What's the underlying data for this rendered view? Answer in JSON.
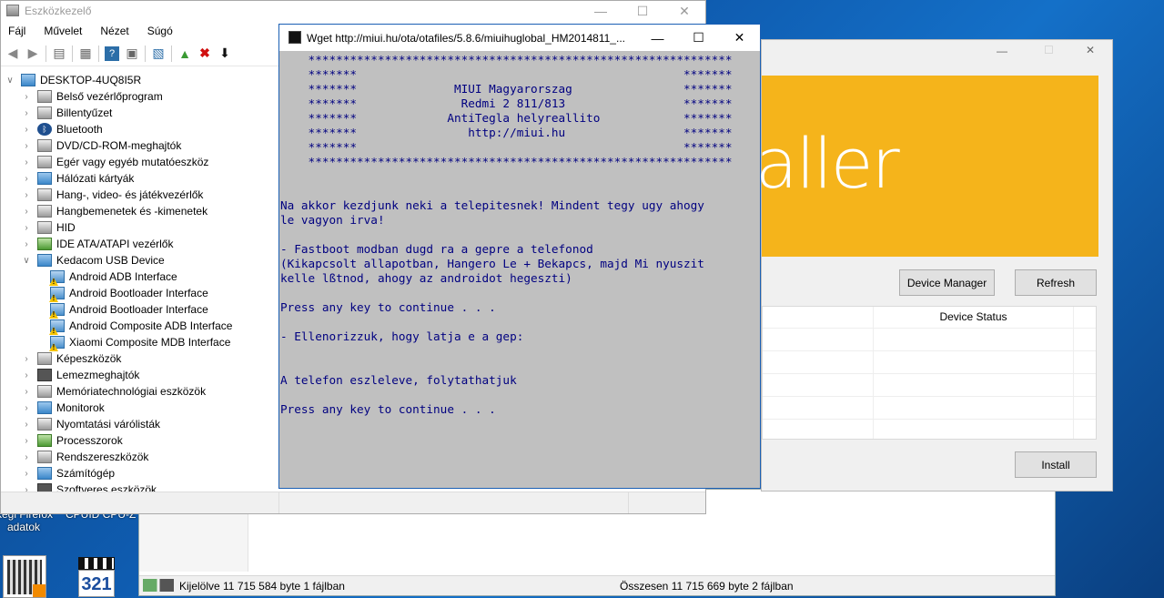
{
  "desktop": {
    "label_left_line1": "kegi Firefox",
    "label_left_line2": "adatok",
    "label_right": "CPUID CPU-Z"
  },
  "explorer": {
    "status_left": "Kijelölve 11 715 584 byte 1 fájlban",
    "status_right": "Összesen 11 715 669 byte 2 fájlban"
  },
  "devmgr": {
    "title": "Eszközkezelő",
    "menu": [
      "Fájl",
      "Művelet",
      "Nézet",
      "Súgó"
    ],
    "root": "DESKTOP-4UQ8I5R",
    "nodes": [
      {
        "label": "Belső vezérlőprogram",
        "icon": "gray"
      },
      {
        "label": "Billentyűzet",
        "icon": "gray"
      },
      {
        "label": "Bluetooth",
        "icon": "bt"
      },
      {
        "label": "DVD/CD-ROM-meghajtók",
        "icon": "gray"
      },
      {
        "label": "Egér vagy egyéb mutatóeszköz",
        "icon": "gray"
      },
      {
        "label": "Hálózati kártyák",
        "icon": "blue"
      },
      {
        "label": "Hang-, video- és játékvezérlők",
        "icon": "gray"
      },
      {
        "label": "Hangbemenetek és -kimenetek",
        "icon": "gray"
      },
      {
        "label": "HID",
        "icon": "gray"
      },
      {
        "label": "IDE ATA/ATAPI vezérlők",
        "icon": "green"
      },
      {
        "label": "Kedacom USB Device",
        "icon": "blue",
        "expanded": true
      },
      {
        "label": "Android ADB Interface",
        "icon": "warn",
        "child": true
      },
      {
        "label": "Android Bootloader Interface",
        "icon": "warn",
        "child": true
      },
      {
        "label": "Android Bootloader Interface",
        "icon": "warn",
        "child": true
      },
      {
        "label": "Android Composite ADB Interface",
        "icon": "warn",
        "child": true
      },
      {
        "label": "Xiaomi Composite MDB Interface",
        "icon": "warn",
        "child": true
      },
      {
        "label": "Képeszközök",
        "icon": "gray"
      },
      {
        "label": "Lemezmeghajtók",
        "icon": "dark"
      },
      {
        "label": "Memóriatechnológiai eszközök",
        "icon": "gray"
      },
      {
        "label": "Monitorok",
        "icon": "blue"
      },
      {
        "label": "Nyomtatási várólisták",
        "icon": "gray"
      },
      {
        "label": "Processzorok",
        "icon": "green"
      },
      {
        "label": "Rendszereszközök",
        "icon": "gray"
      },
      {
        "label": "Számítógép",
        "icon": "blue"
      },
      {
        "label": "Szoftveres eszközök",
        "icon": "dark"
      }
    ]
  },
  "console": {
    "title": "Wget http://miui.hu/ota/otafiles/5.8.6/miuihuglobal_HM2014811_...",
    "text": "    *************************************************************\n    *******                                               *******\n    *******              MIUI Magyarorszag                *******\n    *******               Redmi 2 811/813                 *******\n    *******             AntiTegla helyreallito            *******\n    *******                http://miui.hu                 *******\n    *******                                               *******\n    *************************************************************\n\n\nNa akkor kezdjunk neki a telepitesnek! Mindent tegy ugy ahogy\nle vagyon irva!\n\n- Fastboot modban dugd ra a gepre a telefonod\n(Kikapcsolt allapotban, Hangero Le + Bekapcs, majd Mi nyuszit\nkelle lßtnod, ahogy az androidot hegeszti)\n\nPress any key to continue . . .\n\n- Ellenorizzuk, hogy latja e a gep:\n\n\nA telefon eszleleve, folytathatjuk\n\nPress any key to continue . . ."
  },
  "installer": {
    "banner_text": "aller",
    "device_manager_label": "Device Manager",
    "refresh_label": "Refresh",
    "column_status": "Device Status",
    "install_label": "Install"
  },
  "colors": {
    "banner": "#f5b41b",
    "console_bg": "#c0c0c0",
    "console_text": "#000080"
  }
}
